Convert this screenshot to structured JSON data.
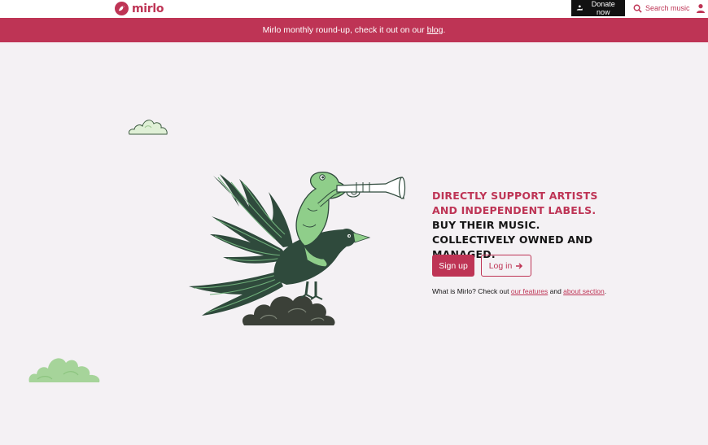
{
  "header": {
    "logo_text": "mirlo",
    "donate_label": "Donate now",
    "search_label": "Search music"
  },
  "banner": {
    "text": "Mirlo monthly round-up, check it out on our",
    "link_text": "blog",
    "suffix": "."
  },
  "hero": {
    "tagline_accent": "Directly support artists and independent labels.",
    "tagline_rest": "Buy their music. Collectively owned and managed.",
    "signup_label": "Sign up",
    "login_label": "Log in",
    "about_prefix": "What is Mirlo? Check out",
    "features_link": "our features",
    "and_text": "and",
    "about_link": "about section",
    "about_suffix": "."
  },
  "icons": {
    "logo": "mirlo-bird-logo-icon",
    "donate": "donate-hand-icon",
    "search": "search-icon",
    "user": "user-icon",
    "login_arrow": "arrow-right-icon"
  },
  "colors": {
    "brand": "#be3455",
    "background": "#f4f1f4",
    "donate_bg": "#111111",
    "bird_dark": "#2f4a3c",
    "frog_green": "#8fce8a"
  }
}
